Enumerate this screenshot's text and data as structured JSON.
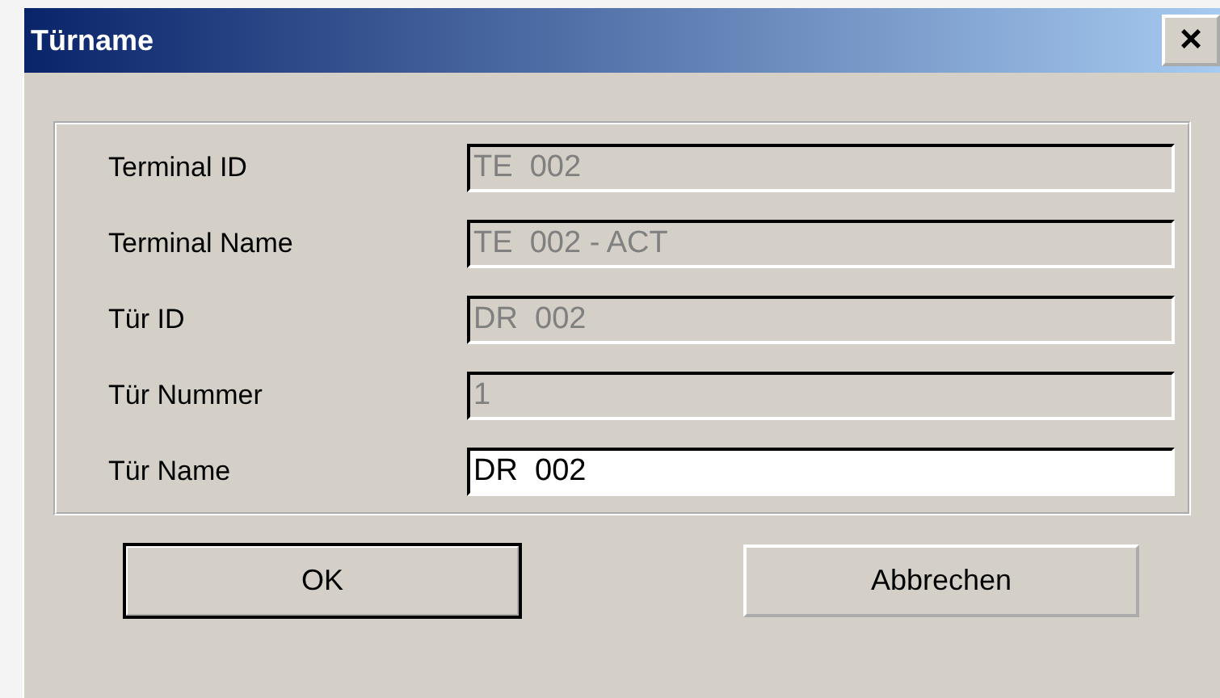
{
  "window": {
    "title": "Türname",
    "close": "×"
  },
  "fields": [
    {
      "label": "Terminal ID",
      "value": "TE  002",
      "disabled": true
    },
    {
      "label": "Terminal Name",
      "value": "TE  002 - ACT",
      "disabled": true
    },
    {
      "label": "Tür ID",
      "value": "DR  002",
      "disabled": true
    },
    {
      "label": "Tür Nummer",
      "value": "1",
      "disabled": true
    },
    {
      "label": "Tür Name",
      "value": "DR  002",
      "disabled": false
    }
  ],
  "buttons": [
    {
      "label": "OK",
      "default": true
    },
    {
      "label": "Abbrechen",
      "default": false
    }
  ]
}
